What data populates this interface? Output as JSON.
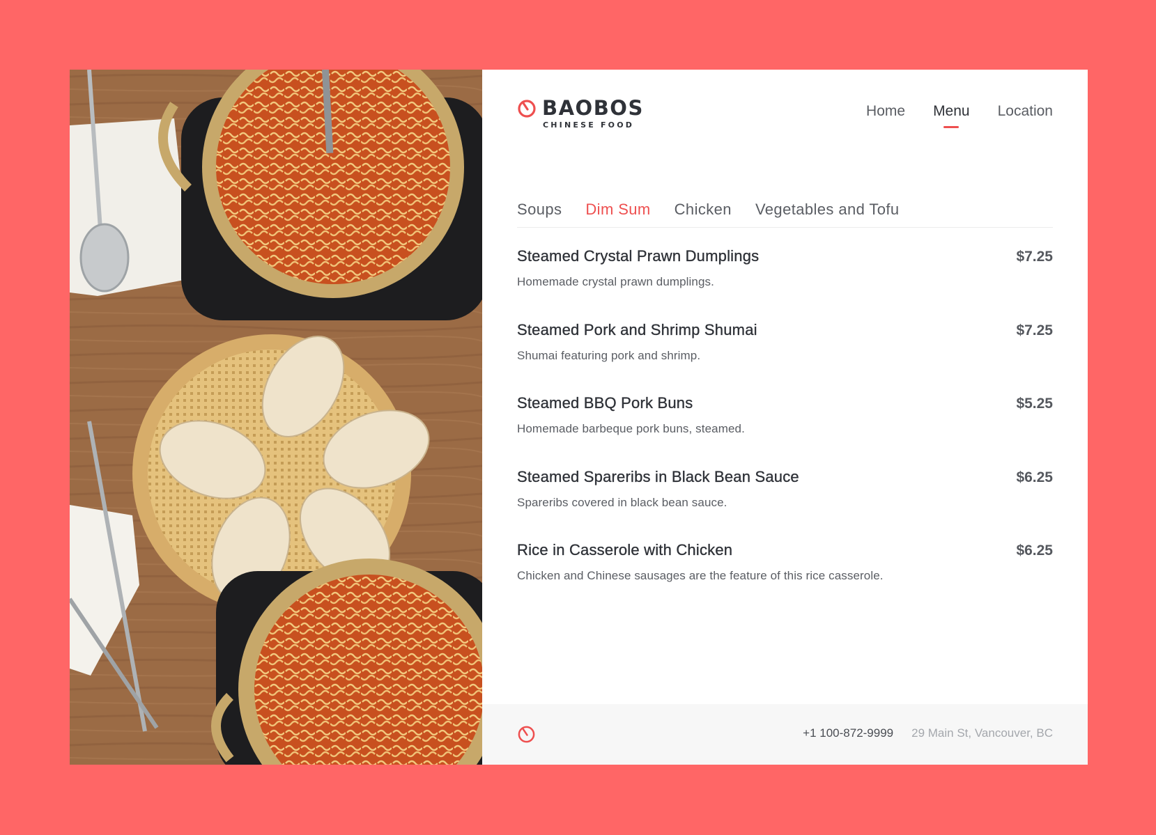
{
  "brand": {
    "name": "BAOBOS",
    "tagline": "CHINESE FOOD",
    "accent": "#ee4f4f"
  },
  "nav": {
    "items": [
      {
        "label": "Home",
        "active": false
      },
      {
        "label": "Menu",
        "active": true
      },
      {
        "label": "Location",
        "active": false
      }
    ]
  },
  "tabs": {
    "items": [
      {
        "label": "Soups",
        "active": false
      },
      {
        "label": "Dim Sum",
        "active": true
      },
      {
        "label": "Chicken",
        "active": false
      },
      {
        "label": "Vegetables and Tofu",
        "active": false
      }
    ]
  },
  "menu": {
    "items": [
      {
        "name": "Steamed Crystal Prawn Dumplings",
        "price": "$7.25",
        "description": "Homemade crystal prawn dumplings."
      },
      {
        "name": "Steamed Pork and Shrimp Shumai",
        "price": "$7.25",
        "description": "Shumai featuring pork and shrimp."
      },
      {
        "name": "Steamed BBQ Pork Buns",
        "price": "$5.25",
        "description": "Homemade barbeque pork buns, steamed."
      },
      {
        "name": "Steamed Spareribs in Black Bean Sauce",
        "price": "$6.25",
        "description": "Spareribs covered in black bean sauce."
      },
      {
        "name": "Rice in Casserole with Chicken",
        "price": "$6.25",
        "description": "Chicken and Chinese sausages are the feature of this rice casserole."
      }
    ]
  },
  "footer": {
    "phone": "+1 100-872-9999",
    "address": "29 Main St, Vancouver, BC"
  },
  "icons": {
    "logo": "baobos-logo-icon",
    "footer_logo": "baobos-footer-logo-icon"
  },
  "colors": {
    "background": "#ff6666",
    "card": "#ffffff",
    "text_dark": "#2f3238",
    "footer_bg": "#f7f7f7"
  }
}
